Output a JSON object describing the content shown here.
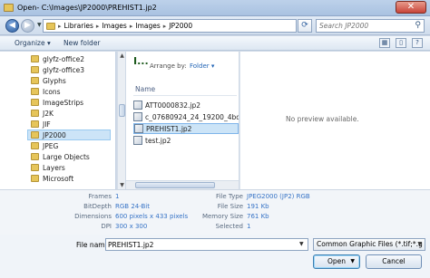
{
  "window": {
    "title": "Open- C:\\Images\\JP2000\\PREHIST1.jp2",
    "close": "✕"
  },
  "address": {
    "breadcrumb": [
      "Libraries",
      "Images",
      "Images",
      "JP2000"
    ],
    "search_placeholder": "Search JP2000"
  },
  "toolbar": {
    "organize": "Organize ▾",
    "new_folder": "New folder"
  },
  "nav_tree": [
    "glyfz-office2",
    "glyfz-office3",
    "Glyphs",
    "Icons",
    "ImageStrips",
    "J2K",
    "JIF",
    "JP2000",
    "JPEG",
    "Large Objects",
    "Layers",
    "Microsoft"
  ],
  "nav_selected": "JP2000",
  "library": {
    "heading": "I...",
    "arrange_label": "Arrange by:",
    "arrange_value": "Folder ▾",
    "column_name": "Name"
  },
  "files": [
    "ATT0000832.jp2",
    "c_07680924_24_19200_4bd_2011",
    "PREHIST1.jp2",
    "test.jp2"
  ],
  "selected_file": "PREHIST1.jp2",
  "preview": {
    "message": "No preview available."
  },
  "details": {
    "left": [
      {
        "label": "Frames",
        "value": "1"
      },
      {
        "label": "BitDepth",
        "value": "RGB 24-Bit"
      },
      {
        "label": "Dimensions",
        "value": "600 pixels x 433 pixels"
      },
      {
        "label": "DPI",
        "value": "300 x 300"
      }
    ],
    "right": [
      {
        "label": "File Type",
        "value": "JPEG2000 (JP2) RGB"
      },
      {
        "label": "File Size",
        "value": "191 Kb"
      },
      {
        "label": "Memory Size",
        "value": "761 Kb"
      },
      {
        "label": "Selected",
        "value": "1"
      }
    ]
  },
  "footer": {
    "file_name_label": "File name:",
    "file_name_value": "PREHIST1.jp2",
    "filter": "Common Graphic Files (*.tif;*.g",
    "open": "Open",
    "cancel": "Cancel"
  },
  "colors": {
    "selection": "#cce4f7",
    "link_blue": "#3673c6",
    "folder": "#e6c55a"
  }
}
